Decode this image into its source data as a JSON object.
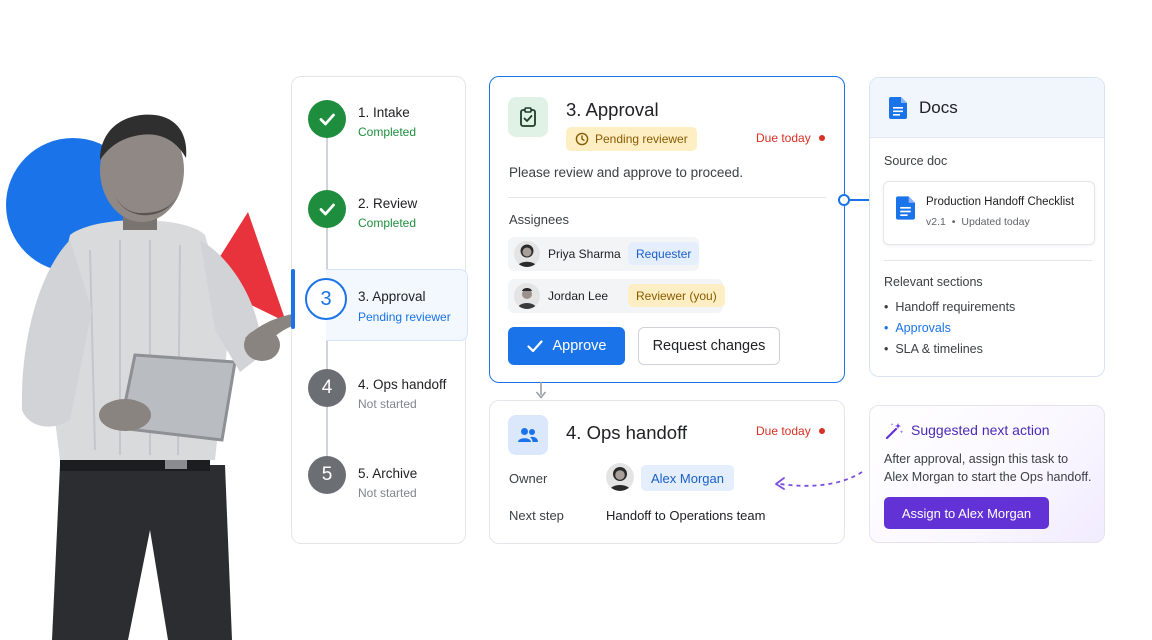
{
  "steps": [
    {
      "title": "1. Intake",
      "status": "Completed"
    },
    {
      "title": "2. Review",
      "status": "Completed"
    },
    {
      "number": "3",
      "title": "3. Approval",
      "status": "Pending reviewer"
    },
    {
      "number": "4",
      "title": "4. Ops handoff",
      "status": "Not started"
    },
    {
      "number": "5",
      "title": "5. Archive",
      "status": "Not started"
    }
  ],
  "approval": {
    "title": "3. Approval",
    "status_chip": "Pending reviewer",
    "due": "Due today",
    "instruction": "Please review and approve to proceed.",
    "assignees_label": "Assignees",
    "assignees": [
      {
        "name": "Priya Sharma",
        "role": "Requester"
      },
      {
        "name": "Jordan Lee",
        "role": "Reviewer (you)"
      }
    ],
    "approve_label": "Approve",
    "request_changes_label": "Request changes"
  },
  "ops": {
    "title": "4. Ops handoff",
    "due": "Due today",
    "owner_label": "Owner",
    "owner_name": "Alex Morgan",
    "next_step_label": "Next step",
    "next_step_value": "Handoff to Operations team"
  },
  "docs": {
    "title": "Docs",
    "source_label": "Source doc",
    "file_name": "Production Handoff Checklist",
    "file_version": "v2.1",
    "file_updated": "Updated today",
    "sections_label": "Relevant sections",
    "sections": [
      "Handoff requirements",
      "Approvals",
      "SLA & timelines"
    ],
    "highlighted_section": "Approvals"
  },
  "suggestion": {
    "title": "Suggested next action",
    "body": "After approval, assign this task to Alex Morgan to start the Ops handoff.",
    "button_label": "Assign to Alex Morgan"
  },
  "colors": {
    "accent": "#1a73e8",
    "success": "#1e8e3e",
    "danger": "#d93025",
    "purple": "#6232d6"
  }
}
